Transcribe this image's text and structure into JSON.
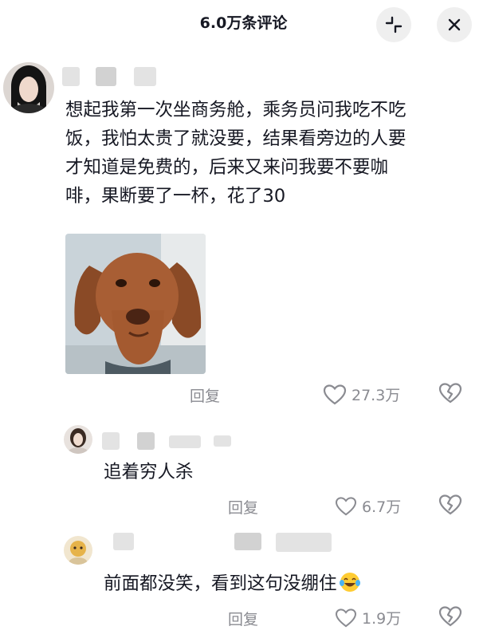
{
  "header": {
    "title": "6.0万条评论",
    "icons": [
      "collapse-icon",
      "close-icon"
    ]
  },
  "comments": [
    {
      "text_lines": [
        "想起我第一次坐商务舱，乘务员问我吃不吃",
        "饭，我怕太贵了就没要，结果看旁边的人要",
        "才知道是免费的，后来又来问我要不要咖",
        "啡，果断要了一杯，花了30"
      ],
      "image": "dog-sticker",
      "reply_label": "回复",
      "likes": "27.3万"
    },
    {
      "text": "追着穷人杀",
      "reply_label": "回复",
      "likes": "6.7万"
    },
    {
      "text": "前面都没笑，看到这句没绷住",
      "emoji": "laughing-crying-emoji",
      "reply_label": "回复",
      "likes": "1.9万"
    }
  ]
}
